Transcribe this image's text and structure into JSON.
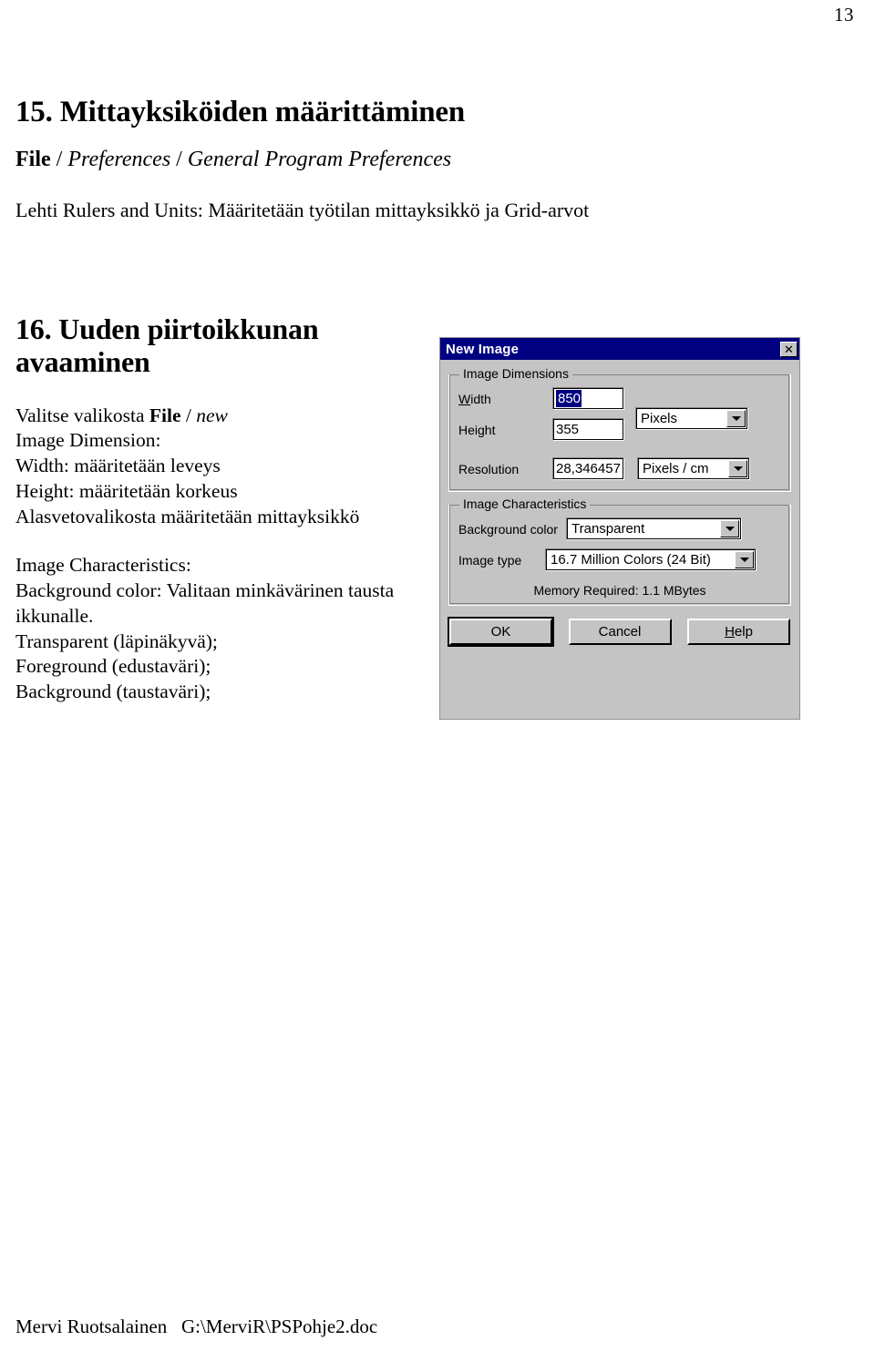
{
  "page": {
    "number": "13",
    "footer": "Mervi Ruotsalainen   G:\\MerviR\\PSPohje2.doc"
  },
  "section_15": {
    "heading": "15. Mittayksiköiden määrittäminen",
    "menu_path_bold": "File",
    "menu_path_sep1": " / ",
    "menu_path_italic1": "Preferences",
    "menu_path_sep2": " / ",
    "menu_path_italic2": "General Program Preferences",
    "lead": "Lehti Rulers and Units: Määritetään työtilan mittayksikkö ja Grid-arvot"
  },
  "section_16": {
    "heading": "16. Uuden piirtoikkunan avaaminen",
    "choose_prefix": "Valitse valikosta ",
    "choose_bold": "File",
    "choose_sep": " / ",
    "choose_italic": "new",
    "dimension_lines": [
      "Image Dimension:",
      "Width: määritetään leveys",
      "Height: määritetään korkeus",
      "Alasvetovalikosta määritetään mittayksikkö"
    ],
    "characteristics_lines": [
      "Image  Characteristics:",
      "Background color: Valitaan minkävärinen tausta",
      "ikkunalle.",
      "Transparent (läpinäkyvä);",
      " Foreground (edustaväri);",
      "Background (taustaväri);"
    ]
  },
  "dialog": {
    "title": "New Image",
    "close_icon": "✕",
    "groups": {
      "dimensions": {
        "label": "Image Dimensions",
        "width_label": "Width",
        "width_label_accel": "W",
        "width_value": "850",
        "height_label": "Height",
        "height_value": "355",
        "resolution_label": "Resolution",
        "resolution_value": "28,346457",
        "size_unit": "Pixels",
        "resolution_unit": "Pixels / cm"
      },
      "characteristics": {
        "label": "Image Characteristics",
        "background_color_label": "Background color",
        "background_color_value": "Transparent",
        "image_type_label": "Image type",
        "image_type_value": "16.7 Million Colors (24 Bit)",
        "memory_required": "Memory Required: 1.1 MBytes"
      }
    },
    "buttons": {
      "ok": "OK",
      "cancel": "Cancel",
      "help": "Help"
    },
    "colors": {
      "titlebar": "#000080",
      "face": "#c0c0c0",
      "selection": "#000080"
    }
  }
}
